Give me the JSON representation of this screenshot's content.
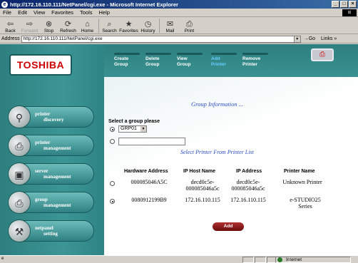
{
  "window": {
    "title": "http://172.16.110.111/NetPanel/cgi.exe - Microsoft Internet Explorer"
  },
  "menu": [
    "File",
    "Edit",
    "View",
    "Favorites",
    "Tools",
    "Help"
  ],
  "toolbar": [
    {
      "label": "Back",
      "icon": "back-arrow-icon"
    },
    {
      "label": "Forward",
      "icon": "forward-arrow-icon"
    },
    {
      "label": "Stop",
      "icon": "stop-icon"
    },
    {
      "label": "Refresh",
      "icon": "refresh-icon"
    },
    {
      "label": "Home",
      "icon": "home-icon"
    },
    {
      "label": "Search",
      "icon": "search-icon"
    },
    {
      "label": "Favorites",
      "icon": "favorites-icon"
    },
    {
      "label": "History",
      "icon": "history-icon"
    },
    {
      "label": "Mail",
      "icon": "mail-icon"
    },
    {
      "label": "Print",
      "icon": "print-icon"
    }
  ],
  "address": {
    "label": "Address",
    "value": "http://172.16.110.111/NetPanel/cgi.exe",
    "go": "Go",
    "links": "Links »"
  },
  "brand": {
    "logo": "TOSHIBA"
  },
  "sidebar": [
    {
      "line1": "printer",
      "line2": "discovery"
    },
    {
      "line1": "printer",
      "line2": "management"
    },
    {
      "line1": "server",
      "line2": "management"
    },
    {
      "line1": "group",
      "line2": "management"
    },
    {
      "line1": "netpanel",
      "line2": "setting"
    }
  ],
  "topnav": [
    {
      "line1": "Create",
      "line2": "Group"
    },
    {
      "line1": "Delete",
      "line2": "Group"
    },
    {
      "line1": "View",
      "line2": "Group"
    },
    {
      "line1": "Add",
      "line2": "Printer"
    },
    {
      "line1": "Remove",
      "line2": "Printer"
    }
  ],
  "main": {
    "section_title": "Group Information ...",
    "select_label": "Select a group please",
    "group_value": "GRP01",
    "new_group_value": "",
    "list_title": "Select Printer From Printer List",
    "headers": [
      "Hardware Address",
      "IP Host Name",
      "IP Address",
      "Printer Name"
    ],
    "rows": [
      {
        "hw": "000085046A5C",
        "host": "decd0c5e-000085046a5c",
        "ip": "decd0c5e-000085046a5c",
        "name": "Unknown Printer",
        "selected": false
      },
      {
        "hw": "0080912199B9",
        "host": "172.16.110.115",
        "ip": "172.16.110.115",
        "name": "e-STUDIO25 Series",
        "selected": true
      }
    ],
    "add_button": "Add"
  },
  "status": {
    "zone": "Internet"
  }
}
